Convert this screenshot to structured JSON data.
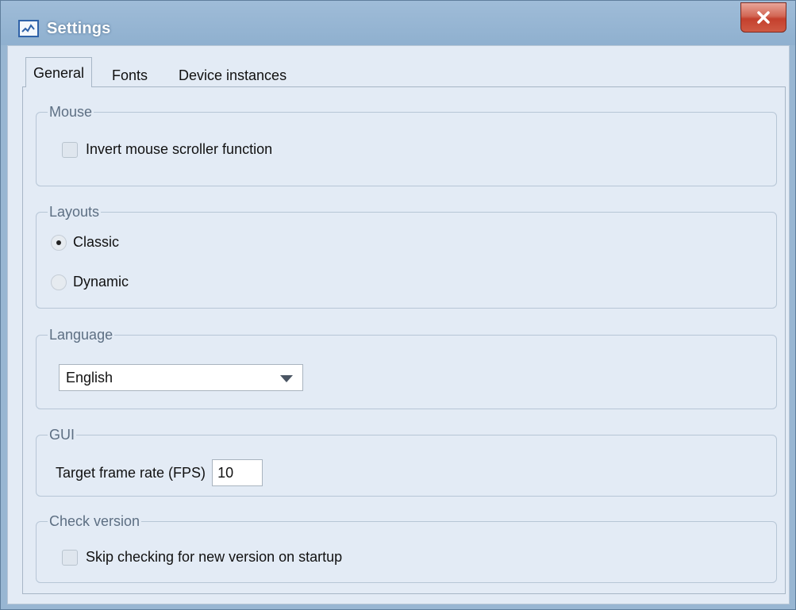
{
  "window": {
    "title": "Settings"
  },
  "tabs": [
    {
      "label": "General",
      "active": true
    },
    {
      "label": "Fonts",
      "active": false
    },
    {
      "label": "Device instances",
      "active": false
    }
  ],
  "groups": {
    "mouse": {
      "title": "Mouse",
      "invert_scroller": {
        "label": "Invert mouse scroller function",
        "checked": false
      }
    },
    "layouts": {
      "title": "Layouts",
      "options": [
        {
          "label": "Classic",
          "selected": true
        },
        {
          "label": "Dynamic",
          "selected": false
        }
      ]
    },
    "language": {
      "title": "Language",
      "selected": "English"
    },
    "gui": {
      "title": "GUI",
      "fps_label": "Target frame rate (FPS)",
      "fps_value": "10"
    },
    "check_version": {
      "title": "Check version",
      "skip_check": {
        "label": "Skip checking for new version on startup",
        "checked": false
      }
    }
  },
  "colors": {
    "titlebar": "#98b6d2",
    "client_bg": "#e3ebf5",
    "close_button": "#c94a36",
    "group_title": "#5d6f83"
  }
}
